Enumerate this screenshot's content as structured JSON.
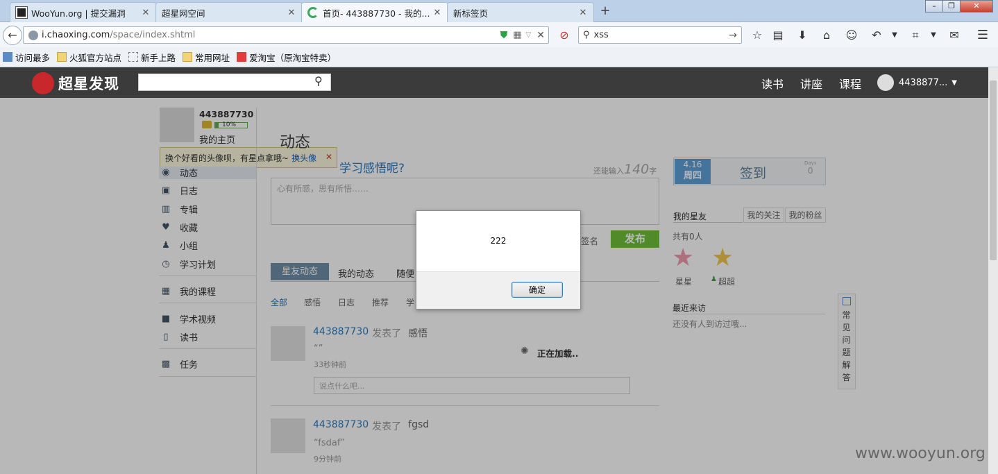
{
  "tabs": [
    {
      "title": "WooYun.org | 提交漏洞"
    },
    {
      "title": "超星网空间"
    },
    {
      "title": "首页- 443887730 - 我的..."
    },
    {
      "title": "新标签页"
    }
  ],
  "window_controls": {
    "minimize": "–",
    "maximize": "❐",
    "close": "✕"
  },
  "address_bar": {
    "domain": "i.chaoxing.com",
    "path": "/space/index.shtml"
  },
  "search_bar": {
    "value": "xss"
  },
  "bookmarks": [
    {
      "label": "访问最多"
    },
    {
      "label": "火狐官方站点"
    },
    {
      "label": "新手上路"
    },
    {
      "label": "常用网址"
    },
    {
      "label": "爱淘宝（原淘宝特卖）"
    }
  ],
  "site": {
    "logo": "超星发现",
    "nav": [
      "读书",
      "讲座",
      "课程"
    ],
    "user": "4438877..."
  },
  "profile": {
    "name": "443887730",
    "progress": "10%",
    "progress_value": 0.1,
    "home_link": "我的主页",
    "tip_text": "换个好看的头像呗，有星点拿哦~",
    "tip_link": "换头像"
  },
  "sidebar": [
    "动态",
    "日志",
    "专辑",
    "收藏",
    "小组",
    "学习计划",
    "我的课程",
    "学术视频",
    "读书",
    "任务"
  ],
  "main": {
    "title": "动态",
    "prompt": "学习感悟呢?",
    "remain": "还能输入",
    "remain_count": "140",
    "remain_unit": "字",
    "placeholder": "心有所感，思有所悟……",
    "sign": "签名",
    "publish": "发布",
    "tabs": [
      "星友动态",
      "我的动态",
      "随便"
    ],
    "filters": [
      "全部",
      "感悟",
      "日志",
      "推荐",
      "学"
    ],
    "loading": "正在加载..",
    "feed": [
      {
        "user": "443887730",
        "action": "发表了",
        "topic": "感悟",
        "content": "“”",
        "time": "33秒钟前",
        "comment_ph": "说点什么吧..."
      },
      {
        "user": "443887730",
        "action": "发表了",
        "topic": "fgsd",
        "content": "“fsdaf”",
        "time": "9分钟前"
      }
    ]
  },
  "right": {
    "date": "4.16",
    "weekday": "周四",
    "checkin": "签到",
    "count_label": "Days",
    "count": "0",
    "friend_tabs": [
      "我的星友",
      "我的关注",
      "我的粉丝"
    ],
    "friends_total": "共有0人",
    "mascots": [
      "星星",
      "超超"
    ],
    "visitors_title": "最近来访",
    "visitors_empty": "还没有人到访过哦...",
    "faq": "常见问题解答"
  },
  "dialog": {
    "message": "222",
    "ok": "确定"
  },
  "watermark": "www.wooyun.org"
}
